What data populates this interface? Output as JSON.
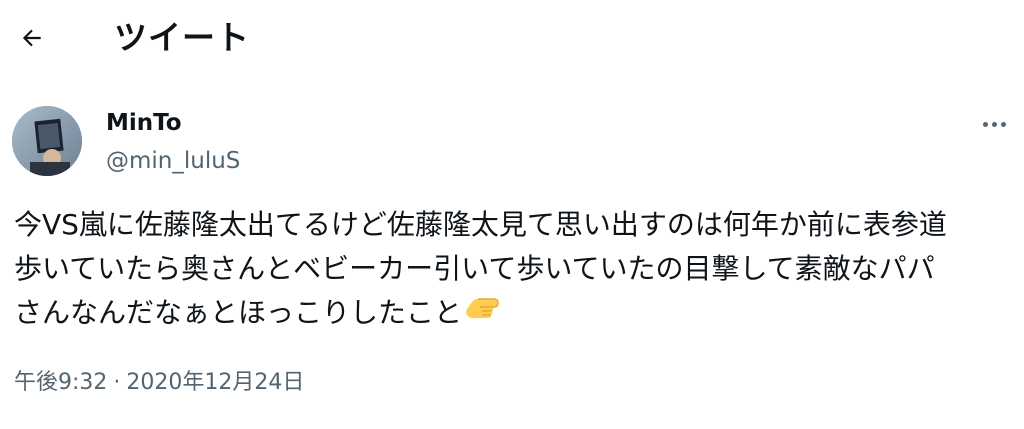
{
  "header": {
    "title": "ツイート",
    "back_icon": "arrow-left-icon"
  },
  "author": {
    "display_name": "MinTo",
    "handle": "@min_luluS",
    "avatar_icon": "user-avatar"
  },
  "tweet": {
    "lines": [
      "今VS嵐に佐藤隆太出てるけど佐藤隆太見て思い出すのは何年か前に表参道",
      "歩いていたら奥さんとベビーカー引いて歩いていたの目撃して素敵なパパ",
      "さんなんだなぁとほっこりしたこと"
    ],
    "emoji": "backhand-index-pointing-left-emoji"
  },
  "meta": {
    "time": "午後9:32",
    "separator": "·",
    "date": "2020年12月24日"
  },
  "more_icon": "more-dots-icon",
  "colors": {
    "text_primary": "#0f1419",
    "text_secondary": "#536471",
    "background": "#ffffff"
  }
}
